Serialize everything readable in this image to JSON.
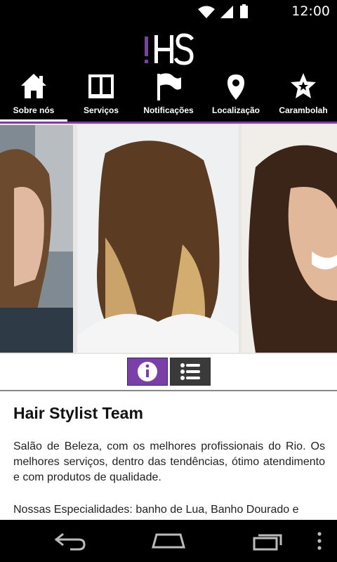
{
  "status_bar": {
    "time": "12:00"
  },
  "brand": {
    "logo_text": "HS",
    "accent": "#7b3fa8"
  },
  "nav": {
    "items": [
      {
        "label": "Sobre nós",
        "icon": "home-icon",
        "active": true
      },
      {
        "label": "Serviços",
        "icon": "book-icon",
        "active": false
      },
      {
        "label": "Notificações",
        "icon": "flag-icon",
        "active": false
      },
      {
        "label": "Localização",
        "icon": "map-pin-icon",
        "active": false
      },
      {
        "label": "Carambolah",
        "icon": "star-badge-icon",
        "active": false
      }
    ]
  },
  "view_toggle": {
    "info_icon": "info-icon",
    "list_icon": "list-icon",
    "selected": "info"
  },
  "content": {
    "title": "Hair Stylist Team",
    "paragraph1": "Salão de Beleza, com os melhores profissionais do Rio. Os melhores serviços, dentro das tendências, ótimo atendimento e com produtos de qualidade.",
    "paragraph2": "Nossas Especialidades: banho de Lua, Banho Dourado e"
  },
  "system_nav": {
    "back": "back-icon",
    "home": "home-key-icon",
    "recents": "recents-icon",
    "menu": "overflow-menu-icon"
  }
}
